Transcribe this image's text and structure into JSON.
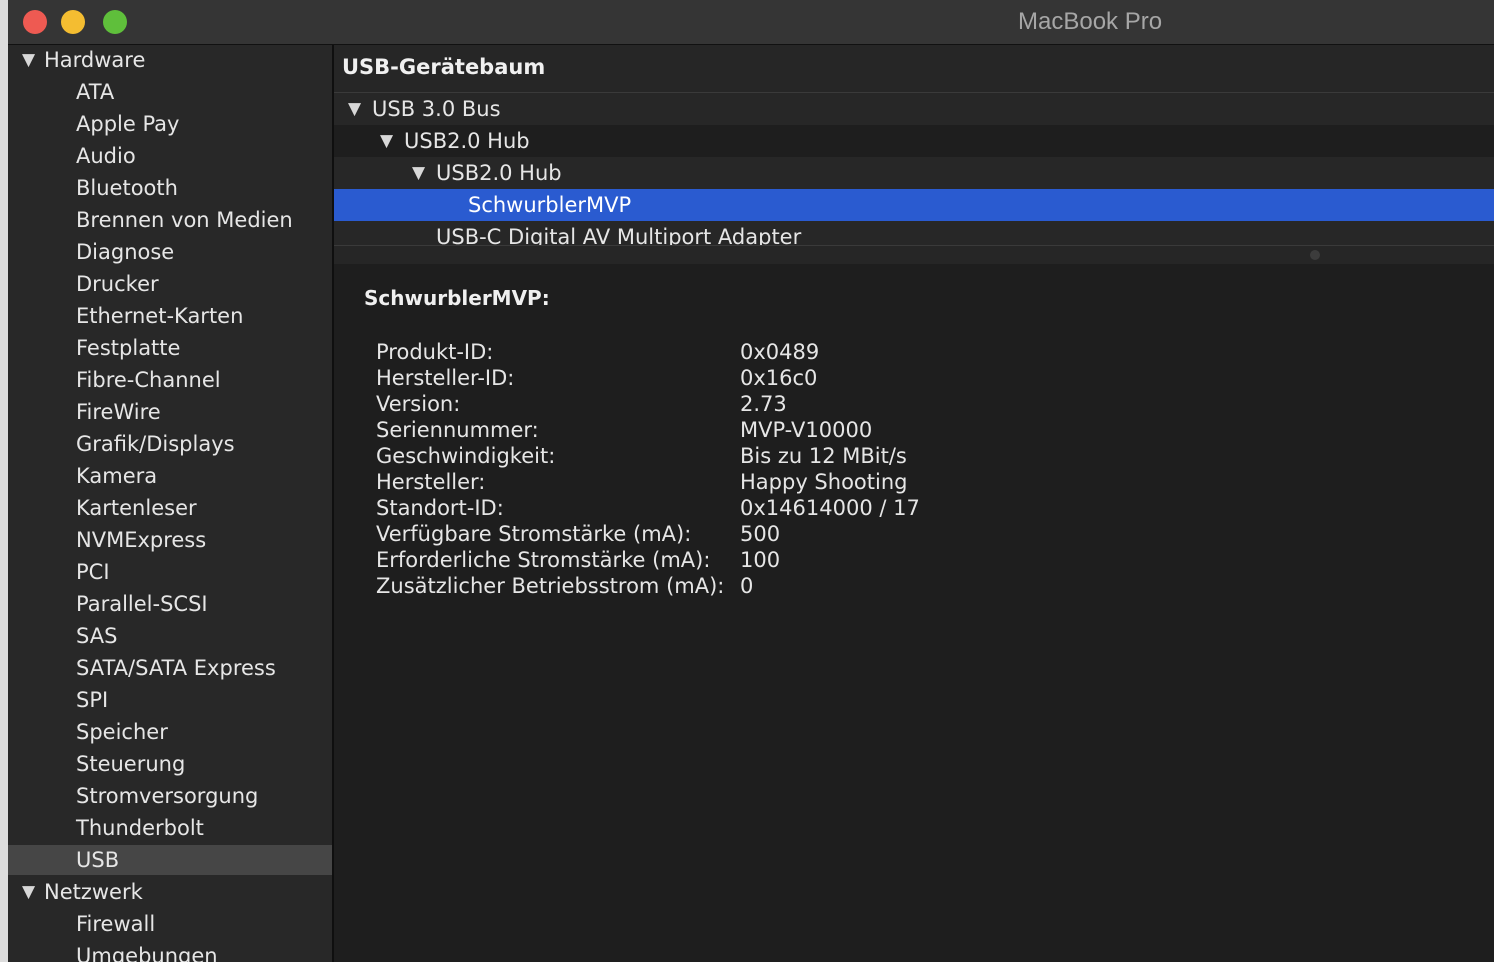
{
  "window": {
    "title": "MacBook Pro"
  },
  "sidebar": {
    "hardware_group": "Hardware",
    "hardware_items": [
      "ATA",
      "Apple Pay",
      "Audio",
      "Bluetooth",
      "Brennen von Medien",
      "Diagnose",
      "Drucker",
      "Ethernet-Karten",
      "Festplatte",
      "Fibre-Channel",
      "FireWire",
      "Grafik/Displays",
      "Kamera",
      "Kartenleser",
      "NVMExpress",
      "PCI",
      "Parallel-SCSI",
      "SAS",
      "SATA/SATA Express",
      "SPI",
      "Speicher",
      "Steuerung",
      "Stromversorgung",
      "Thunderbolt",
      "USB"
    ],
    "selected_item": "USB",
    "network_group": "Netzwerk",
    "network_items": [
      "Firewall",
      "Umgebungen"
    ]
  },
  "pane": {
    "title": "USB-Gerätebaum"
  },
  "tree": [
    {
      "label": "USB 3.0 Bus",
      "level": 0,
      "expanded": true,
      "selected": false
    },
    {
      "label": "USB2.0 Hub",
      "level": 1,
      "expanded": true,
      "selected": false
    },
    {
      "label": "USB2.0 Hub",
      "level": 2,
      "expanded": true,
      "selected": false
    },
    {
      "label": "SchwurblerMVP",
      "level": 3,
      "expanded": false,
      "selected": true
    },
    {
      "label": "USB-C Digital AV Multiport Adapter",
      "level": 2,
      "expanded": false,
      "selected": false
    }
  ],
  "detail": {
    "title": "SchwurblerMVP:",
    "properties": [
      {
        "key": "Produkt-ID:",
        "value": "0x0489"
      },
      {
        "key": "Hersteller-ID:",
        "value": "0x16c0"
      },
      {
        "key": "Version:",
        "value": "2.73"
      },
      {
        "key": "Seriennummer:",
        "value": "MVP-V10000"
      },
      {
        "key": "Geschwindigkeit:",
        "value": "Bis zu 12 MBit/s"
      },
      {
        "key": "Hersteller:",
        "value": "Happy Shooting"
      },
      {
        "key": "Standort-ID:",
        "value": "0x14614000 / 17"
      },
      {
        "key": "Verfügbare Stromstärke (mA):",
        "value": "500"
      },
      {
        "key": "Erforderliche Stromstärke (mA):",
        "value": "100"
      },
      {
        "key": "Zusätzlicher Betriebsstrom (mA):",
        "value": "0"
      }
    ]
  },
  "icons": {
    "disclosure_open": "▼",
    "window_controls": [
      "close-button",
      "minimize-button",
      "zoom-button"
    ]
  },
  "colors": {
    "selection": "#2a5bd0",
    "close": "#ee5a52",
    "minimize": "#f4bd31",
    "zoom": "#5fbf3b"
  }
}
